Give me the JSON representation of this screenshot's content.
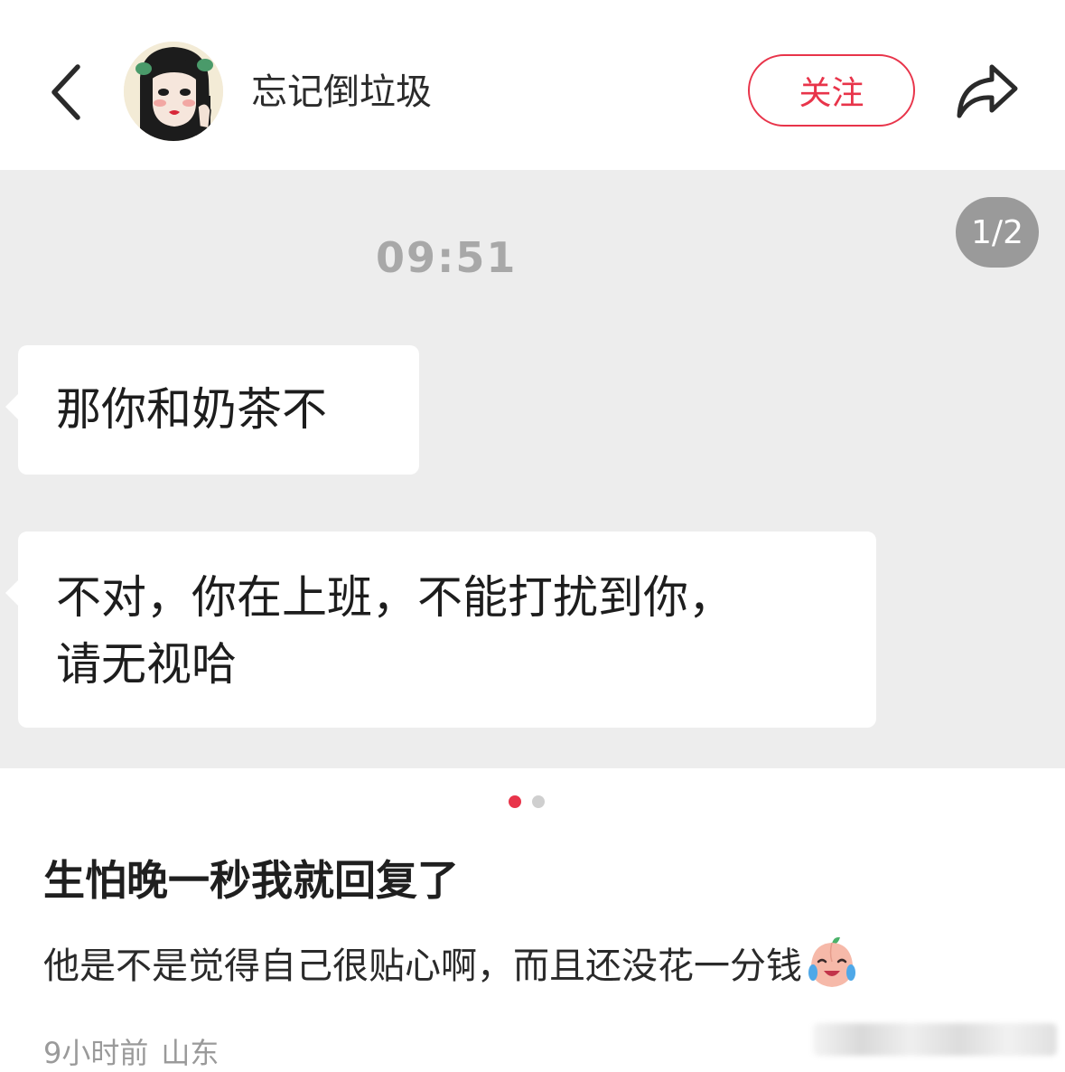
{
  "header": {
    "back_icon": "chevron-left-icon",
    "avatar_icon": "illustrated-girl-avatar",
    "username": "忘记倒垃圾",
    "follow_label": "关注",
    "share_icon": "share-arrow-icon"
  },
  "carousel": {
    "page_indicator": "1/2",
    "current_page": 1,
    "total_pages": 2,
    "chat": {
      "time": "09:51",
      "messages": [
        {
          "lines": [
            "那你和奶茶不"
          ]
        },
        {
          "lines": [
            "不对，你在上班，不能打扰到你，",
            "请无视哈"
          ]
        }
      ]
    }
  },
  "dots": {
    "active_color": "#e8344a",
    "inactive_color": "#cfcfcf"
  },
  "post": {
    "title": "生怕晚一秒我就回复了",
    "body": "他是不是觉得自己很贴心啊，而且还没花一分钱",
    "body_emoji": "crying-peach-emoji",
    "time_ago": "9小时前",
    "location": "山东"
  },
  "colors": {
    "accent": "#e8344a",
    "carousel_bg": "#ededed",
    "bubble_bg": "#ffffff"
  }
}
